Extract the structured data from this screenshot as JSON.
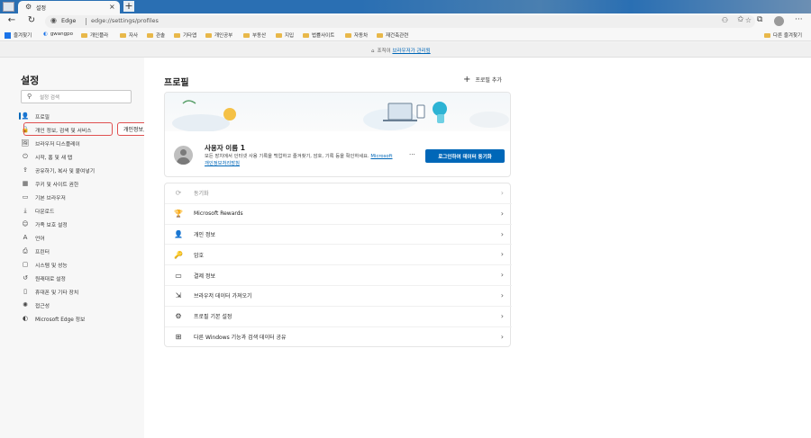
{
  "tab": {
    "title": "설정"
  },
  "address_bar": {
    "browser_label": "Edge",
    "url": "edge://settings/profiles"
  },
  "bookmarks": [
    {
      "label": "즐겨찾기",
      "kind": "app"
    },
    {
      "label": "gwangpo",
      "kind": "edge"
    },
    {
      "label": "개인플라",
      "kind": "folder"
    },
    {
      "label": "자사",
      "kind": "folder"
    },
    {
      "label": "관솔",
      "kind": "folder"
    },
    {
      "label": "기타앱",
      "kind": "folder"
    },
    {
      "label": "개인공부",
      "kind": "folder"
    },
    {
      "label": "부동산",
      "kind": "folder"
    },
    {
      "label": "지입",
      "kind": "folder"
    },
    {
      "label": "법률사이트",
      "kind": "folder"
    },
    {
      "label": "자동차",
      "kind": "folder"
    },
    {
      "label": "재건축관련",
      "kind": "folder"
    }
  ],
  "other_favorites": "다른 즐겨찾기",
  "infobar": {
    "prefix": "조직이 ",
    "link": "브라우저가 관리됨"
  },
  "sidebar": {
    "title": "설정",
    "search_placeholder": "설정 검색",
    "items": [
      {
        "label": "프로필",
        "icon": "👤"
      },
      {
        "label": "개인 정보, 검색 및 서비스",
        "icon": "🔒"
      },
      {
        "label": "브라우저 디스플레이",
        "icon": "🖼"
      },
      {
        "label": "시작, 홈 및 새 탭",
        "icon": "⏻"
      },
      {
        "label": "공유하기, 복사 및 붙여넣기",
        "icon": "⇪"
      },
      {
        "label": "쿠키 및 사이트 권한",
        "icon": "▦"
      },
      {
        "label": "기본 브라우저",
        "icon": "▭"
      },
      {
        "label": "다운로드",
        "icon": "⤓"
      },
      {
        "label": "가족 보호 설정",
        "icon": "☺"
      },
      {
        "label": "언어",
        "icon": "A"
      },
      {
        "label": "프린터",
        "icon": "⎙"
      },
      {
        "label": "시스템 및 성능",
        "icon": "▢"
      },
      {
        "label": "원래대로 설정",
        "icon": "↺"
      },
      {
        "label": "휴대폰 및 기타 장치",
        "icon": "▯"
      },
      {
        "label": "접근성",
        "icon": "✺"
      },
      {
        "label": "Microsoft Edge 정보",
        "icon": "◐"
      }
    ]
  },
  "callout": "개인정보, 검색 및 서비스를 눌러주세요",
  "main": {
    "title": "프로필",
    "add_profile": "프로필 추가",
    "profile": {
      "name": "사용자 이름 1",
      "desc": "모든 장치에서 인터넷 사용 기록을 백업하고 즐겨찾기, 암호, 기록 등을 확인하세요.",
      "link": "Microsoft 개인정보처리방침",
      "more": "···",
      "sync_button": "로그인하여 데이터 동기화"
    },
    "settings": [
      {
        "label": "동기화",
        "icon": "⟳",
        "dim": true
      },
      {
        "label": "Microsoft Rewards",
        "icon": "🏆",
        "dim": false
      },
      {
        "label": "개인 정보",
        "icon": "👤",
        "dim": false
      },
      {
        "label": "암호",
        "icon": "🔑",
        "dim": false
      },
      {
        "label": "결제 정보",
        "icon": "▭",
        "dim": false
      },
      {
        "label": "브라우저 데이터 가져오기",
        "icon": "⇲",
        "dim": false
      },
      {
        "label": "프로필 기본 설정",
        "icon": "⚙",
        "dim": false
      },
      {
        "label": "다른 Windows 기능과 검색 데이터 공유",
        "icon": "⊞",
        "dim": false
      }
    ]
  }
}
